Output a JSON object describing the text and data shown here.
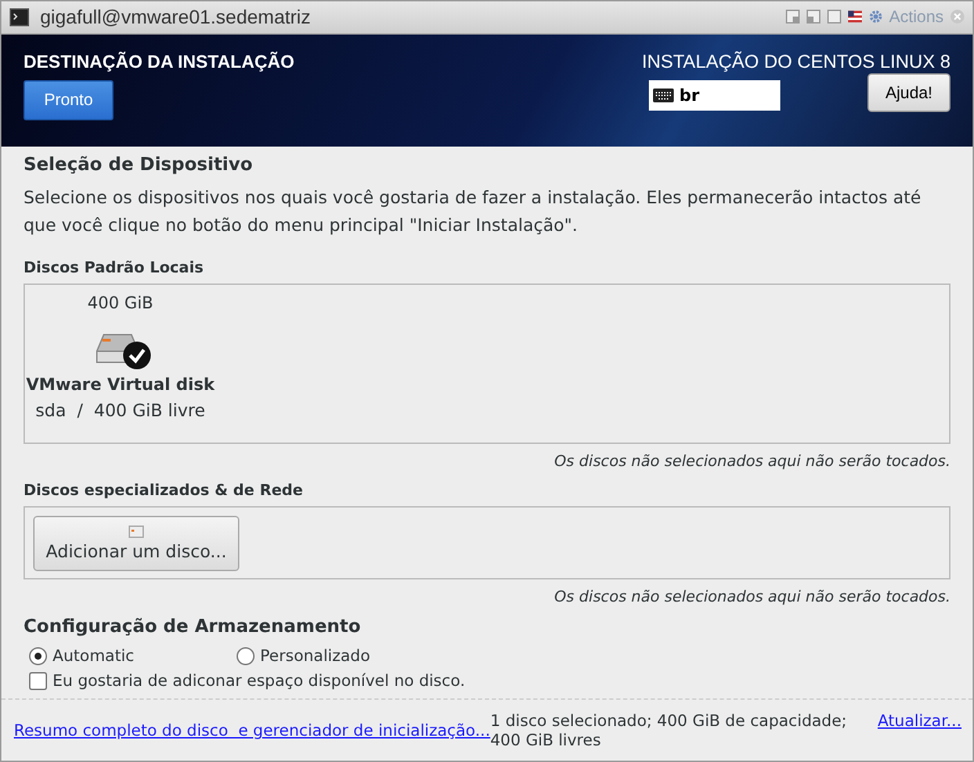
{
  "window": {
    "title": "gigafull@vmware01.sedematriz",
    "actions": "Actions"
  },
  "header": {
    "title": "DESTINAÇÃO DA INSTALAÇÃO",
    "done_button": "Pronto",
    "product": "INSTALAÇÃO DO CENTOS LINUX 8",
    "keyboard_layout": "br",
    "help_button": "Ajuda!"
  },
  "device_selection": {
    "heading": "Seleção de Dispositivo",
    "description": "Selecione os dispositivos nos quais você gostaria de fazer a instalação.  Eles permanecerão intactos até que você clique no botão do menu principal \"Iniciar Instalação\".",
    "local_disks": {
      "label": "Discos Padrão Locais",
      "disks": [
        {
          "size": "400 GiB",
          "name": "VMware Virtual disk",
          "details": "sda  /  400 GiB livre",
          "selected": true
        }
      ],
      "note": "Os discos não selecionados aqui não serão tocados."
    },
    "network_disks": {
      "label": "Discos especializados & de Rede",
      "add_button": "Adicionar um disco...",
      "note": "Os discos não selecionados aqui não serão tocados."
    }
  },
  "storage_config": {
    "heading": "Configuração de Armazenamento",
    "options": [
      {
        "label": "Automatic",
        "selected": true
      },
      {
        "label": "Personalizado",
        "selected": false
      }
    ],
    "extra_space": {
      "label": "Eu gostaria de adiconar espaço disponível no disco.",
      "checked": false
    }
  },
  "footer": {
    "summary_link": "Resumo completo do disco  e gerenciador de inicialização...",
    "status": "1 disco selecionado; 400 GiB de capacidade; 400 GiB livres",
    "refresh_link": "Atualizar..."
  }
}
